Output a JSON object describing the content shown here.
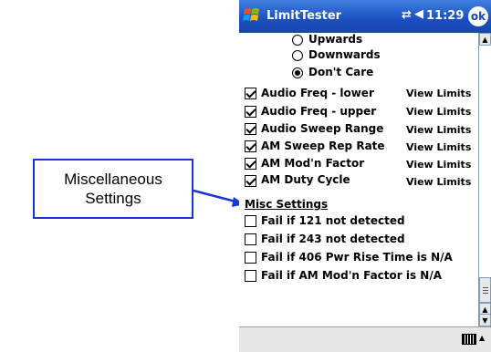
{
  "callout": {
    "line1": "Miscellaneous",
    "line2": "Settings",
    "border_color": "#1a35d6"
  },
  "titlebar": {
    "app_title": "LimitTester",
    "time": "11:29",
    "ok_label": "ok",
    "connectivity_icon": "connectivity-icon",
    "speaker_icon": "speaker-icon",
    "start_icon": "windows-start-icon"
  },
  "direction": {
    "options": [
      {
        "label": "Upwards",
        "selected": false
      },
      {
        "label": "Downwards",
        "selected": false
      },
      {
        "label": "Don't Care",
        "selected": true
      }
    ]
  },
  "limits": [
    {
      "label": "Audio Freq - lower",
      "checked": true,
      "link": "View Limits"
    },
    {
      "label": "Audio Freq - upper",
      "checked": true,
      "link": "View Limits"
    },
    {
      "label": "Audio Sweep Range",
      "checked": true,
      "link": "View Limits"
    },
    {
      "label": "AM Sweep Rep Rate",
      "checked": true,
      "link": "View Limits"
    },
    {
      "label": "AM Mod'n Factor",
      "checked": true,
      "link": "View Limits"
    },
    {
      "label": "AM Duty Cycle",
      "checked": true,
      "link": "View Limits"
    }
  ],
  "misc": {
    "heading": "Misc Settings",
    "items": [
      {
        "label": "Fail if 121 not detected",
        "checked": false
      },
      {
        "label": "Fail if 243 not detected",
        "checked": false
      },
      {
        "label": "Fail if 406 Pwr Rise Time is N/A",
        "checked": false
      },
      {
        "label": "Fail if AM Mod'n Factor is N/A",
        "checked": false
      }
    ]
  },
  "scrollbar": {
    "up_icon": "scroll-up-icon",
    "down_icon": "scroll-down-icon"
  },
  "bottombar": {
    "keyboard_icon": "keyboard-icon"
  },
  "colors": {
    "titlebar": "#1b4fbf",
    "accent": "#1a35d6"
  }
}
